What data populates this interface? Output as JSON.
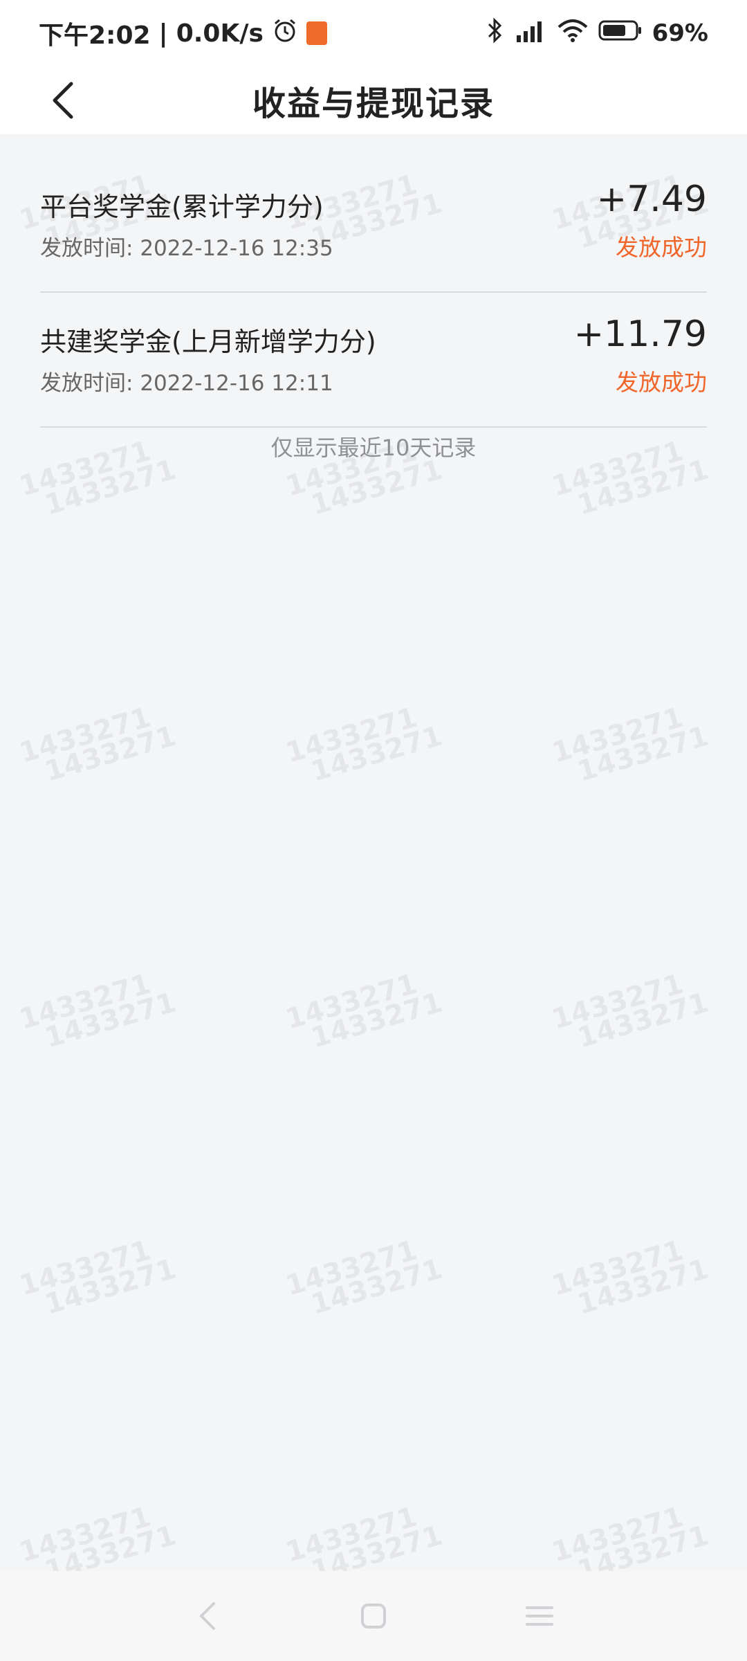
{
  "status_bar": {
    "time": "下午2:02",
    "network_speed": "0.0K/s",
    "separator": "|",
    "alarm_icon": "alarm-icon",
    "battery_percent": "69%"
  },
  "header": {
    "title": "收益与提现记录",
    "back_icon": "back-arrow-icon"
  },
  "records": [
    {
      "title": "平台奖学金(累计学力分)",
      "time_label": "发放时间:",
      "time": "2022-12-16 12:35",
      "amount": "+7.49",
      "status": "发放成功"
    },
    {
      "title": "共建奖学金(上月新增学力分)",
      "time_label": "发放时间:",
      "time": "2022-12-16 12:11",
      "amount": "+11.79",
      "status": "发放成功"
    }
  ],
  "footnote": "仅显示最近10天记录",
  "watermark_text": "1433271",
  "colors": {
    "accent": "#f0652a",
    "background": "#f4f5f7",
    "text": "#222222"
  }
}
